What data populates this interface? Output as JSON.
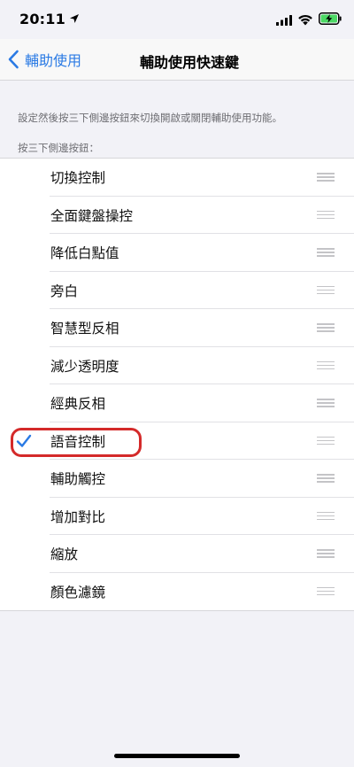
{
  "status_bar": {
    "time": "20:11",
    "icons": [
      "location-arrow-icon",
      "cellular-signal-icon",
      "wifi-icon",
      "battery-charging-icon"
    ]
  },
  "nav": {
    "back_label": "輔助使用",
    "title": "輔助使用快速鍵"
  },
  "description": "設定然後按三下側邊按鈕來切換開啟或關閉輔助使用功能。",
  "section_header": "按三下側邊按鈕：",
  "items": [
    {
      "label": "切換控制",
      "checked": false
    },
    {
      "label": "全面鍵盤操控",
      "checked": false
    },
    {
      "label": "降低白點值",
      "checked": false
    },
    {
      "label": "旁白",
      "checked": false
    },
    {
      "label": "智慧型反相",
      "checked": false
    },
    {
      "label": "減少透明度",
      "checked": false
    },
    {
      "label": "經典反相",
      "checked": false
    },
    {
      "label": "語音控制",
      "checked": true
    },
    {
      "label": "輔助觸控",
      "checked": false
    },
    {
      "label": "增加對比",
      "checked": false
    },
    {
      "label": "縮放",
      "checked": false
    },
    {
      "label": "顏色濾鏡",
      "checked": false
    }
  ],
  "colors": {
    "accent": "#2a7ae4",
    "highlight_ring": "#d42a2a",
    "battery_charging": "#4cd964"
  }
}
